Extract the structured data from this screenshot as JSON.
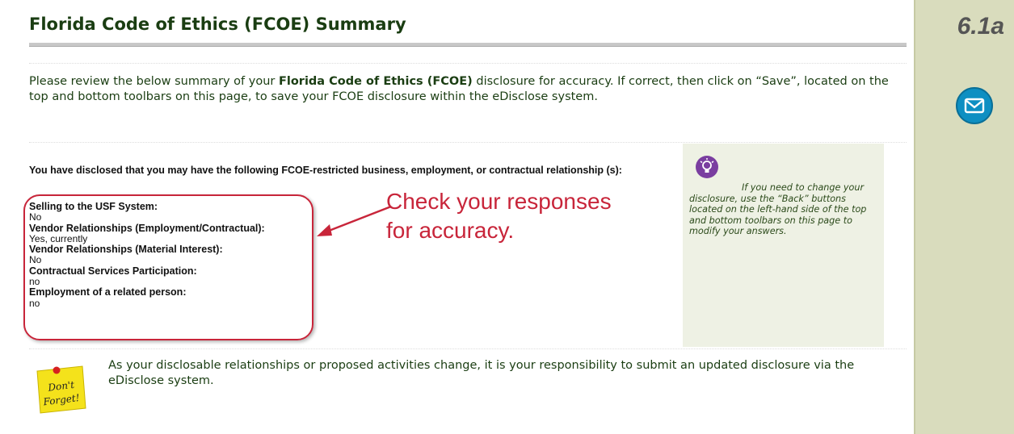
{
  "header": {
    "title": "Florida Code of Ethics (FCOE) Summary"
  },
  "sidebar": {
    "slide_number": "6.1a",
    "mail_icon": "envelope-icon"
  },
  "intro": {
    "before": "Please review the below summary of your ",
    "bold": "Florida Code of Ethics (FCOE)",
    "after": " disclosure for accuracy.  If correct, then click on “Save”, located on the top and bottom toolbars on this page, to save your FCOE disclosure within the eDisclose system."
  },
  "disclosed_heading": "You have disclosed that you may have the following FCOE-restricted business, employment, or contractual relationship (s):",
  "responses": [
    {
      "question": "Selling to the USF System:",
      "answer": "No"
    },
    {
      "question": "Vendor Relationships (Employment/Contractual):",
      "answer": "Yes, currently"
    },
    {
      "question": "Vendor Relationships (Material Interest):",
      "answer": "No"
    },
    {
      "question": "Contractual Services Participation:",
      "answer": "no"
    },
    {
      "question": "Employment of a related person:",
      "answer": "no"
    }
  ],
  "callout": {
    "line1": "Check your responses",
    "line2": "for accuracy."
  },
  "tip": {
    "icon": "lightbulb-icon",
    "text": "If you need to change your disclosure, use the “Back” buttons located on the left-hand side of the top and bottom toolbars on this page to modify your answers."
  },
  "reminder": {
    "note_line1": "Don't",
    "note_line2": "Forget!",
    "text": "As your disclosable relationships or proposed activities change, it is your responsibility to submit an updated disclosure via the eDisclose system."
  },
  "colors": {
    "accent_red": "#c8253a",
    "sidebar": "#d9dcbd",
    "heading_green": "#1a3d12",
    "mail_blue": "#0e8fc2"
  }
}
